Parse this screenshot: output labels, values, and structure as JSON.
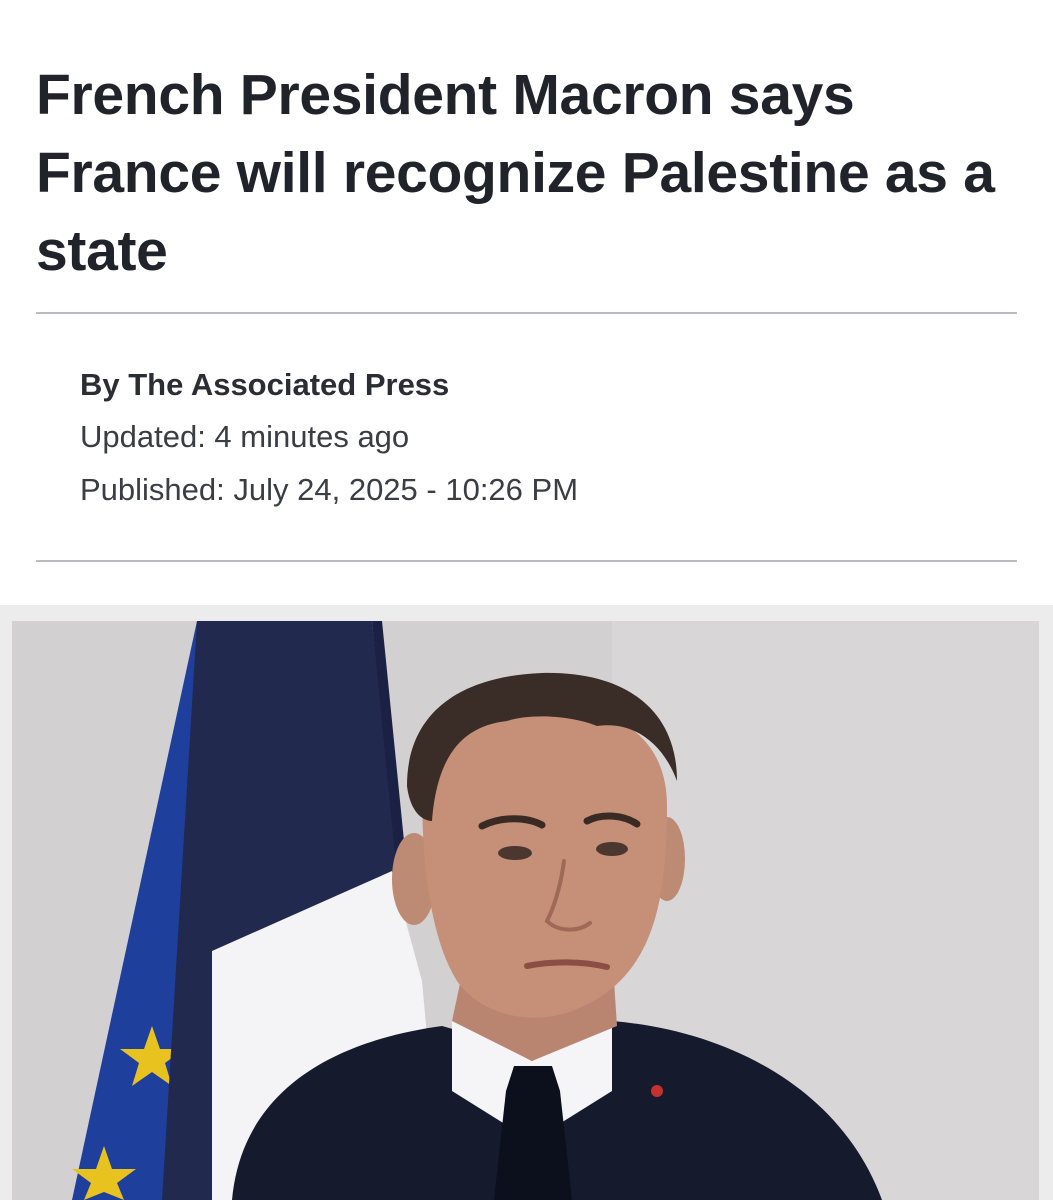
{
  "article": {
    "headline": "French President Macron says France will recognize Palestine as a state",
    "byline": "By The Associated Press",
    "updated": "Updated: 4 minutes ago",
    "published": "Published: July 24, 2025 - 10:26 PM"
  },
  "photo": {
    "subject": "Man in dark suit and tie in front of French and European flags",
    "colors": {
      "background": "#d3d0d1",
      "eu_blue": "#1f3f9c",
      "flag_navy": "#22294f",
      "flag_white": "#f4f3f5",
      "suit": "#151a2c",
      "skin": "#c58f78",
      "hair": "#3a2c26"
    }
  }
}
